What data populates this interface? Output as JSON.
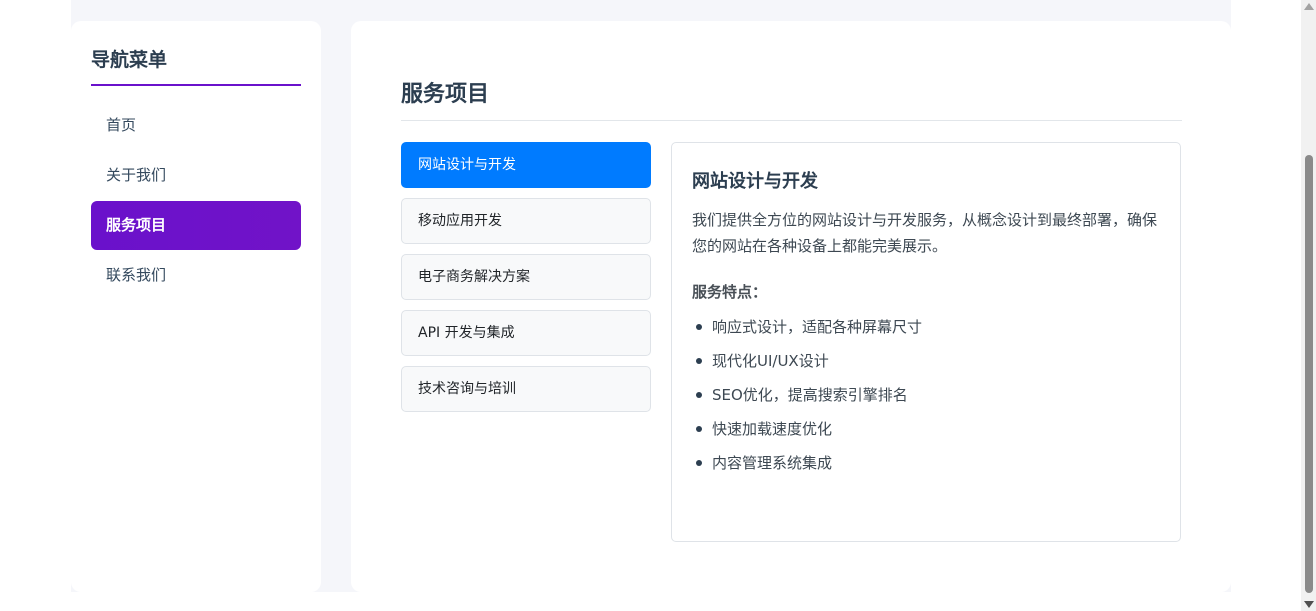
{
  "colors": {
    "accent": "#6a11cb",
    "tab_active": "#007bff",
    "page_bg": "#f5f6fa"
  },
  "sidebar": {
    "title": "导航菜单",
    "items": [
      {
        "label": "首页",
        "active": false
      },
      {
        "label": "关于我们",
        "active": false
      },
      {
        "label": "服务项目",
        "active": true
      },
      {
        "label": "联系我们",
        "active": false
      }
    ]
  },
  "main": {
    "title": "服务项目",
    "tabs": [
      {
        "label": "网站设计与开发",
        "active": true
      },
      {
        "label": "移动应用开发",
        "active": false
      },
      {
        "label": "电子商务解决方案",
        "active": false
      },
      {
        "label": "API 开发与集成",
        "active": false
      },
      {
        "label": "技术咨询与培训",
        "active": false
      }
    ],
    "panel": {
      "title": "网站设计与开发",
      "description": "我们提供全方位的网站设计与开发服务，从概念设计到最终部署，确保您的网站在各种设备上都能完美展示。",
      "features_title": "服务特点：",
      "features": [
        "响应式设计，适配各种屏幕尺寸",
        "现代化UI/UX设计",
        "SEO优化，提高搜索引擎排名",
        "快速加载速度优化",
        "内容管理系统集成"
      ]
    }
  }
}
